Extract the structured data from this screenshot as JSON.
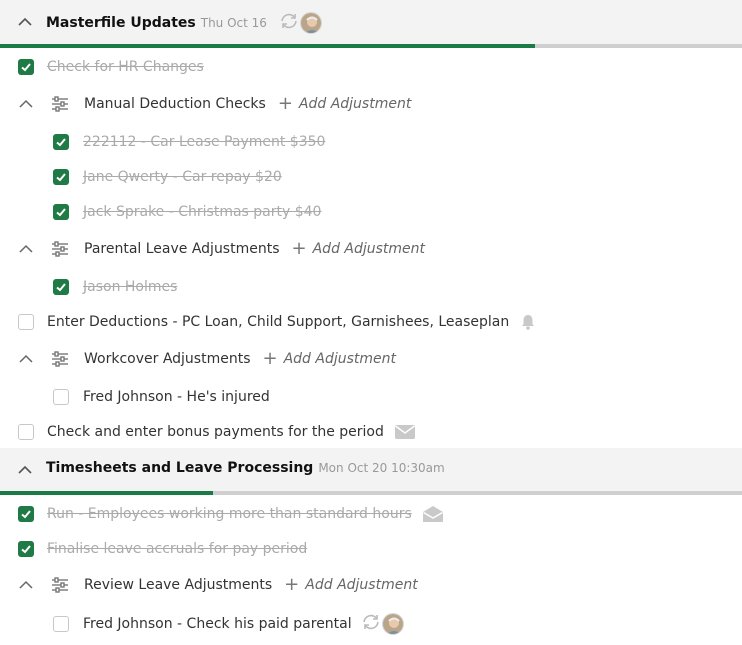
{
  "colors": {
    "accent": "#1f7a45",
    "progress_track": "#cfcfcf",
    "header_bg": "#f3f3f3"
  },
  "sections": [
    {
      "title": "Masterfile Updates",
      "date": "Thu Oct 16",
      "progress_fraction": 0.72,
      "icons": [
        "sync-icon",
        "avatar"
      ],
      "items": [
        {
          "type": "task",
          "label": "Check for HR Changes",
          "checked": true
        },
        {
          "type": "group",
          "label": "Manual Deduction Checks",
          "action": "Add Adjustment",
          "items": [
            {
              "label": "222112 - Car Lease Payment $350",
              "checked": true
            },
            {
              "label": "Jane Qwerty - Car repay $20",
              "checked": true
            },
            {
              "label": "Jack Sprake - Christmas party $40",
              "checked": true
            }
          ]
        },
        {
          "type": "group",
          "label": "Parental Leave Adjustments",
          "action": "Add Adjustment",
          "items": [
            {
              "label": "Jason Holmes",
              "checked": true
            }
          ]
        },
        {
          "type": "task",
          "label": "Enter Deductions - PC Loan, Child Support, Garnishees, Leaseplan",
          "checked": false,
          "icon": "bell-icon"
        },
        {
          "type": "group",
          "label": "Workcover Adjustments",
          "action": "Add Adjustment",
          "items": [
            {
              "label": "Fred Johnson - He's injured",
              "checked": false
            }
          ]
        },
        {
          "type": "task",
          "label": "Check and enter bonus payments for the period",
          "checked": false,
          "icon": "envelope-icon"
        }
      ]
    },
    {
      "title": "Timesheets and Leave Processing",
      "date": "Mon Oct 20 10:30am",
      "progress_fraction": 0.29,
      "items": [
        {
          "type": "task",
          "label": "Run - Employees working more than standard hours",
          "checked": true,
          "icon": "envelope-open-icon"
        },
        {
          "type": "task",
          "label": "Finalise leave accruals for pay period",
          "checked": true
        },
        {
          "type": "group",
          "label": "Review Leave Adjustments",
          "action": "Add Adjustment",
          "items": [
            {
              "label": "Fred Johnson - Check his paid parental",
              "checked": false,
              "icons": [
                "sync-icon",
                "avatar"
              ]
            }
          ]
        }
      ]
    }
  ]
}
